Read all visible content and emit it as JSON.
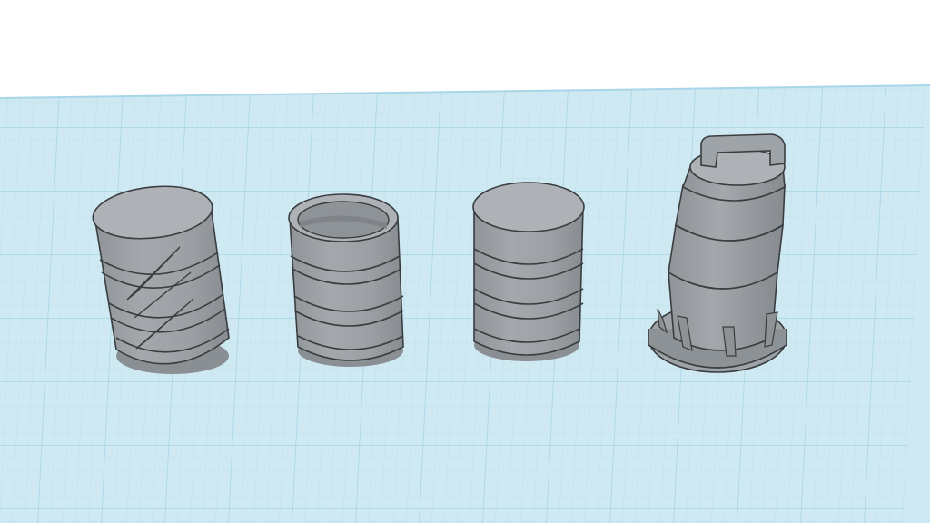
{
  "scene": {
    "background_color": "#ffffff",
    "grid": {
      "surface_color": "#cfe9f3",
      "major_line_color": "#9fd0e3",
      "minor_line_color": "#b9deec",
      "edge_color": "#a8d6e8",
      "visible": true
    },
    "model_color": "#9ea3a7",
    "model_top_color": "#aeb2b6",
    "model_shadow_color": "#8a8f93",
    "outline_color": "#3a3d40",
    "objects": [
      {
        "name": "slashed-barrel",
        "kind": "barrel-closed-with-slash-marks"
      },
      {
        "name": "open-barrel",
        "kind": "barrel-open-top"
      },
      {
        "name": "closed-barrel",
        "kind": "barrel-closed"
      },
      {
        "name": "traffic-cone",
        "kind": "tapered-cone-with-handle"
      }
    ]
  }
}
